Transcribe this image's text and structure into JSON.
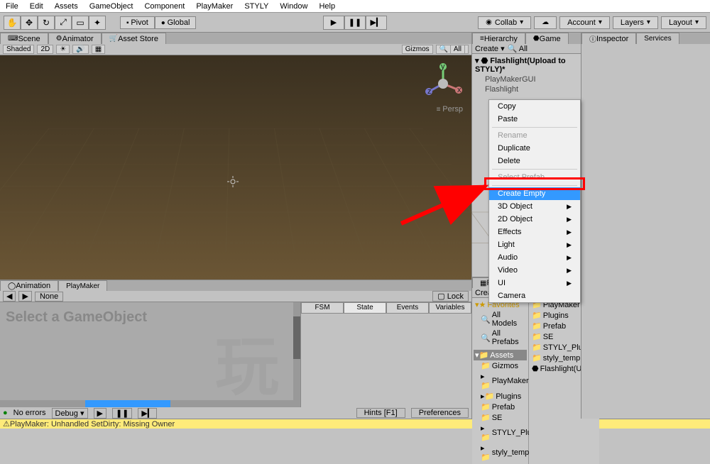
{
  "menubar": {
    "items": [
      "File",
      "Edit",
      "Assets",
      "GameObject",
      "Component",
      "PlayMaker",
      "STYLY",
      "Window",
      "Help"
    ]
  },
  "toolbar": {
    "pivot": "Pivot",
    "global": "Global",
    "collab": "Collab",
    "account": "Account",
    "layers": "Layers",
    "layout": "Layout"
  },
  "tabs": {
    "scene": "Scene",
    "animator": "Animator",
    "assetstore": "Asset Store",
    "animation": "Animation",
    "playmaker": "PlayMaker",
    "hierarchy": "Hierarchy",
    "game": "Game",
    "project": "Project",
    "inspector": "Inspector",
    "services": "Services"
  },
  "scene_toolbar": {
    "shaded": "Shaded",
    "twod": "2D",
    "gizmos": "Gizmos",
    "all": "All"
  },
  "viewport": {
    "persp": "Persp"
  },
  "hierarchy": {
    "create": "Create",
    "scene_name": "Flashlight(Upload to STYLY)*",
    "items": [
      "PlayMakerGUI",
      "Flashlight"
    ]
  },
  "context_menu": {
    "copy": "Copy",
    "paste": "Paste",
    "rename": "Rename",
    "duplicate": "Duplicate",
    "delete": "Delete",
    "select_prefab": "Select Prefab",
    "create_empty": "Create Empty",
    "three_d": "3D Object",
    "two_d": "2D Object",
    "effects": "Effects",
    "light": "Light",
    "audio": "Audio",
    "video": "Video",
    "ui": "UI",
    "camera": "Camera"
  },
  "project": {
    "create": "Create",
    "favorites": "Favorites",
    "all_models": "All Models",
    "all_prefabs": "All Prefabs",
    "assets": "Assets",
    "folders": [
      "Gizmos",
      "PlayMaker",
      "Plugins",
      "Prefab",
      "SE",
      "STYLY_Plugin",
      "styly_temp"
    ],
    "items": [
      "PlayMaker",
      "Plugins",
      "Prefab",
      "SE",
      "STYLY_Plugin",
      "styly_temp",
      "Flashlight(Uploa"
    ]
  },
  "playmaker": {
    "none": "None",
    "lock": "Lock",
    "select_msg": "Select a GameObject",
    "fsm": "FSM",
    "state": "State",
    "events": "Events",
    "variables": "Variables",
    "no_errors": "No errors",
    "debug": "Debug",
    "hints": "Hints [F1]",
    "preferences": "Preferences"
  },
  "status": {
    "message": "PlayMaker: Unhandled SetDirty: Missing Owner"
  }
}
